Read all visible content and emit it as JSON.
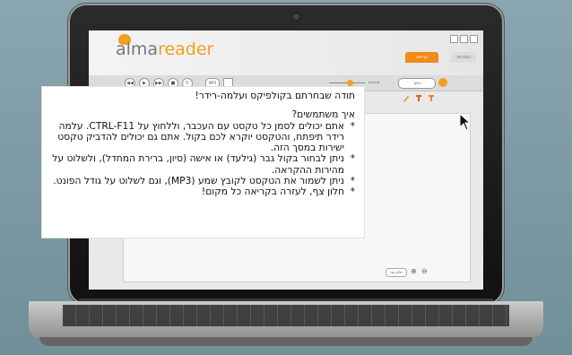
{
  "app": {
    "logo_alma": "alma",
    "logo_reader": "reader"
  },
  "tabs": {
    "reading": "קריאה",
    "settings": "הגדרות"
  },
  "toolbar": {
    "mp3_label": "MP3",
    "speed_label": "מהירות",
    "voice_label": "גלעד"
  },
  "document": {
    "line_1": "תודה שבחרתם בקולפיקס ועלמה-רידר!",
    "line_2": "איך משתמשים?",
    "bullet_1": "אתם יכולים לסמן כל טקסט עם העכבר, וללחוץ על CTRL-F11. עלמה רידר תיפתח, והטקסט יוקרא לכם בקול. אתם גם יכולים להדביק טקסט ישירות במסך הזה.",
    "bullet_2": "ניתן לבחור בקול גבר (גילעד) או אישה (סיון, ברירת המחדל), ולשלוט על מהירות ההקראה.",
    "bullet_3": "ניתן לשמור את הטקסט לקובץ שמע (MP3), וגם לשלוט על גודל הפונט.",
    "bullet_4": "חלון צף, לעזרה בקריאה כל מקום!",
    "bullet_mark": "*"
  },
  "footer": {
    "pill_label": "חלון צף"
  },
  "colors": {
    "accent": "#f08a18",
    "lid": "#1b1b1b"
  }
}
